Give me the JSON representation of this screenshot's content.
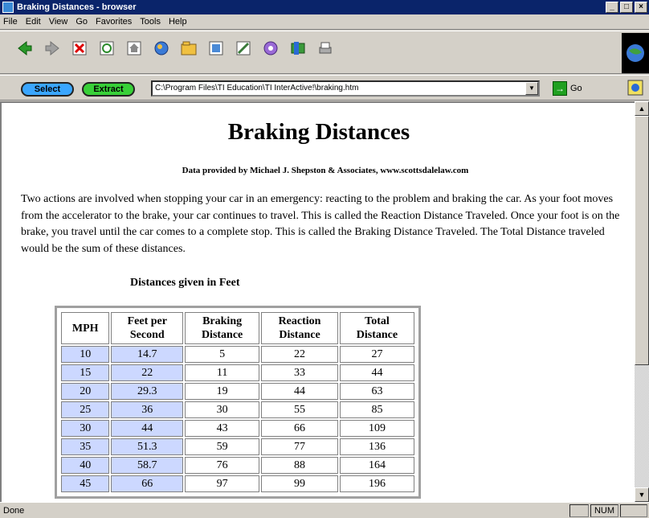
{
  "window": {
    "title": "Braking Distances - browser"
  },
  "menu": [
    "File",
    "Edit",
    "View",
    "Go",
    "Favorites",
    "Tools",
    "Help"
  ],
  "toolbar_icons": [
    "back-icon",
    "forward-icon",
    "stop-icon",
    "refresh-icon",
    "home-icon",
    "search-icon",
    "favorites-icon",
    "history-icon",
    "channels-icon",
    "fullscreen-icon",
    "mail-icon",
    "print-icon"
  ],
  "addressbar": {
    "select_label": "Select",
    "extract_label": "Extract",
    "url": "C:\\Program Files\\TI Education\\TI InterActive!\\braking.htm",
    "go_label": "Go"
  },
  "page": {
    "title": "Braking Distances",
    "credit": "Data provided by Michael J. Shepston & Associates, www.scottsdalelaw.com",
    "paragraph": "Two actions are involved when stopping your car in an emergency:  reacting to the problem and braking the car. As your foot moves from the accelerator to the brake, your car continues to travel.  This is called the Reaction Distance Traveled.  Once your foot is on the brake, you travel until the car comes to a complete stop.  This is called the Braking Distance Traveled.  The Total Distance traveled would be the sum of these distances.",
    "table_caption": "Distances given in Feet",
    "table": {
      "headers": [
        [
          "MPH"
        ],
        [
          "Feet per",
          "Second"
        ],
        [
          "Braking",
          "Distance"
        ],
        [
          "Reaction",
          "Distance"
        ],
        [
          "Total",
          "Distance"
        ]
      ],
      "rows": [
        [
          "10",
          "14.7",
          "5",
          "22",
          "27"
        ],
        [
          "15",
          "22",
          "11",
          "33",
          "44"
        ],
        [
          "20",
          "29.3",
          "19",
          "44",
          "63"
        ],
        [
          "25",
          "36",
          "30",
          "55",
          "85"
        ],
        [
          "30",
          "44",
          "43",
          "66",
          "109"
        ],
        [
          "35",
          "51.3",
          "59",
          "77",
          "136"
        ],
        [
          "40",
          "58.7",
          "76",
          "88",
          "164"
        ],
        [
          "45",
          "66",
          "97",
          "99",
          "196"
        ]
      ]
    }
  },
  "status": {
    "text": "Done",
    "num": "NUM"
  },
  "colors": {
    "titlebar": "#0a246a",
    "highlight_cell": "#ccd8ff",
    "select_button": "#3aa6ff",
    "extract_button": "#38d038"
  }
}
